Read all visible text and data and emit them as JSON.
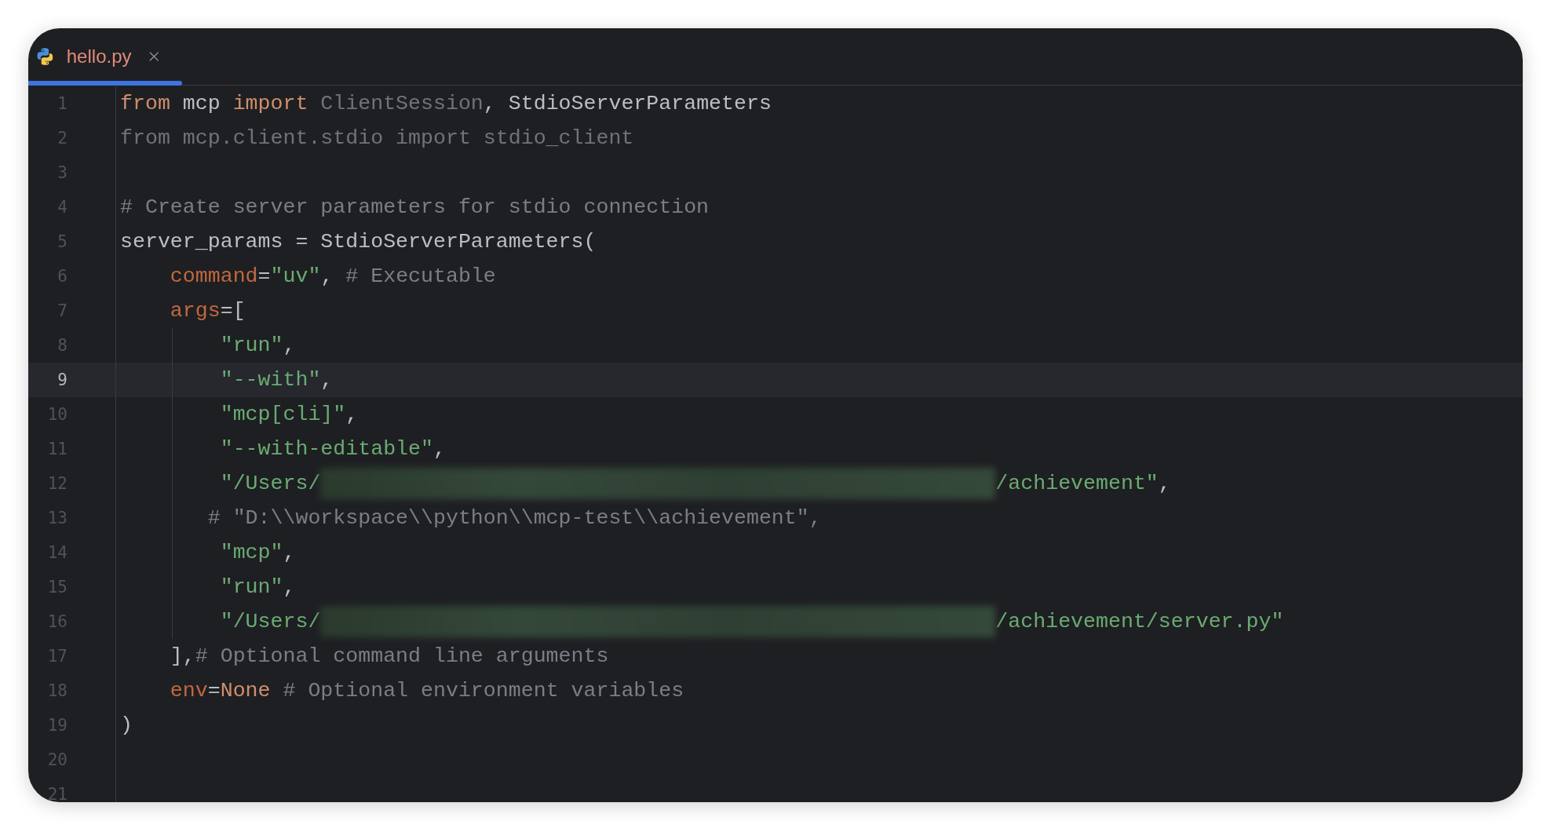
{
  "tabs": [
    {
      "label": "hello.py",
      "selected": true
    }
  ],
  "lines": [
    {
      "number": "1",
      "current": false,
      "indent_guide": false,
      "tokens": [
        {
          "kind": "keyword",
          "text": "from"
        },
        {
          "kind": "plain",
          "text": " mcp "
        },
        {
          "kind": "keyword",
          "text": "import"
        },
        {
          "kind": "unused",
          "text": " ClientSession"
        },
        {
          "kind": "plain",
          "text": ", StdioServerParameters"
        }
      ]
    },
    {
      "number": "2",
      "current": false,
      "indent_guide": false,
      "tokens": [
        {
          "kind": "unused",
          "text": "from mcp.client.stdio import stdio_client"
        }
      ]
    },
    {
      "number": "3",
      "current": false,
      "indent_guide": false
    },
    {
      "number": "4",
      "current": false,
      "indent_guide": false,
      "tokens": [
        {
          "kind": "comment",
          "text": "# Create server parameters for stdio connection"
        }
      ]
    },
    {
      "number": "5",
      "current": false,
      "indent_guide": false,
      "tokens": [
        {
          "kind": "plain",
          "text": "server_params = StdioServerParameters("
        }
      ]
    },
    {
      "number": "6",
      "current": false,
      "indent_guide": false,
      "tokens": [
        {
          "kind": "param",
          "text": "    command"
        },
        {
          "kind": "plain",
          "text": "="
        },
        {
          "kind": "string",
          "text": "\"uv\""
        },
        {
          "kind": "plain",
          "text": ", "
        },
        {
          "kind": "comment",
          "text": "# Executable"
        }
      ]
    },
    {
      "number": "7",
      "current": false,
      "indent_guide": false,
      "tokens": [
        {
          "kind": "param",
          "text": "    args"
        },
        {
          "kind": "plain",
          "text": "=["
        }
      ]
    },
    {
      "number": "8",
      "current": false,
      "indent_guide": true,
      "tokens": [
        {
          "kind": "string",
          "text": "        \"run\""
        },
        {
          "kind": "plain",
          "text": ","
        }
      ]
    },
    {
      "number": "9",
      "current": true,
      "indent_guide": true,
      "tokens": [
        {
          "kind": "string",
          "text": "        \"--with\""
        },
        {
          "kind": "plain",
          "text": ","
        }
      ]
    },
    {
      "number": "10",
      "current": false,
      "indent_guide": true,
      "tokens": [
        {
          "kind": "string",
          "text": "        \"mcp[cli]\""
        },
        {
          "kind": "plain",
          "text": ","
        }
      ]
    },
    {
      "number": "11",
      "current": false,
      "indent_guide": true,
      "tokens": [
        {
          "kind": "string",
          "text": "        \"--with-editable\""
        },
        {
          "kind": "plain",
          "text": ","
        }
      ]
    },
    {
      "number": "12",
      "current": false,
      "indent_guide": true,
      "tokens": [
        {
          "kind": "string",
          "text": "        \"/Users/"
        },
        {
          "kind": "redacted"
        },
        {
          "kind": "string",
          "text": "/achievement\""
        },
        {
          "kind": "plain",
          "text": ","
        }
      ]
    },
    {
      "number": "13",
      "current": false,
      "indent_guide": true,
      "tokens": [
        {
          "kind": "comment",
          "text": "       # \"D:\\\\workspace\\\\python\\\\mcp-test\\\\achievement\","
        }
      ]
    },
    {
      "number": "14",
      "current": false,
      "indent_guide": true,
      "tokens": [
        {
          "kind": "string",
          "text": "        \"mcp\""
        },
        {
          "kind": "plain",
          "text": ","
        }
      ]
    },
    {
      "number": "15",
      "current": false,
      "indent_guide": true,
      "tokens": [
        {
          "kind": "string",
          "text": "        \"run\""
        },
        {
          "kind": "plain",
          "text": ","
        }
      ]
    },
    {
      "number": "16",
      "current": false,
      "indent_guide": true,
      "tokens": [
        {
          "kind": "string",
          "text": "        \"/Users/"
        },
        {
          "kind": "redacted"
        },
        {
          "kind": "string",
          "text": "/achievement/server.py\""
        }
      ]
    },
    {
      "number": "17",
      "current": false,
      "indent_guide": false,
      "tokens": [
        {
          "kind": "plain",
          "text": "    ],"
        },
        {
          "kind": "comment",
          "text": "# Optional command line arguments"
        }
      ]
    },
    {
      "number": "18",
      "current": false,
      "indent_guide": false,
      "tokens": [
        {
          "kind": "param",
          "text": "    env"
        },
        {
          "kind": "plain",
          "text": "="
        },
        {
          "kind": "keyword",
          "text": "None"
        },
        {
          "kind": "comment",
          "text": " # Optional environment variables"
        }
      ]
    },
    {
      "number": "19",
      "current": false,
      "indent_guide": false,
      "tokens": [
        {
          "kind": "plain",
          "text": ")"
        }
      ]
    },
    {
      "number": "20",
      "current": false,
      "indent_guide": false
    },
    {
      "number": "21",
      "current": false,
      "indent_guide": false
    }
  ]
}
